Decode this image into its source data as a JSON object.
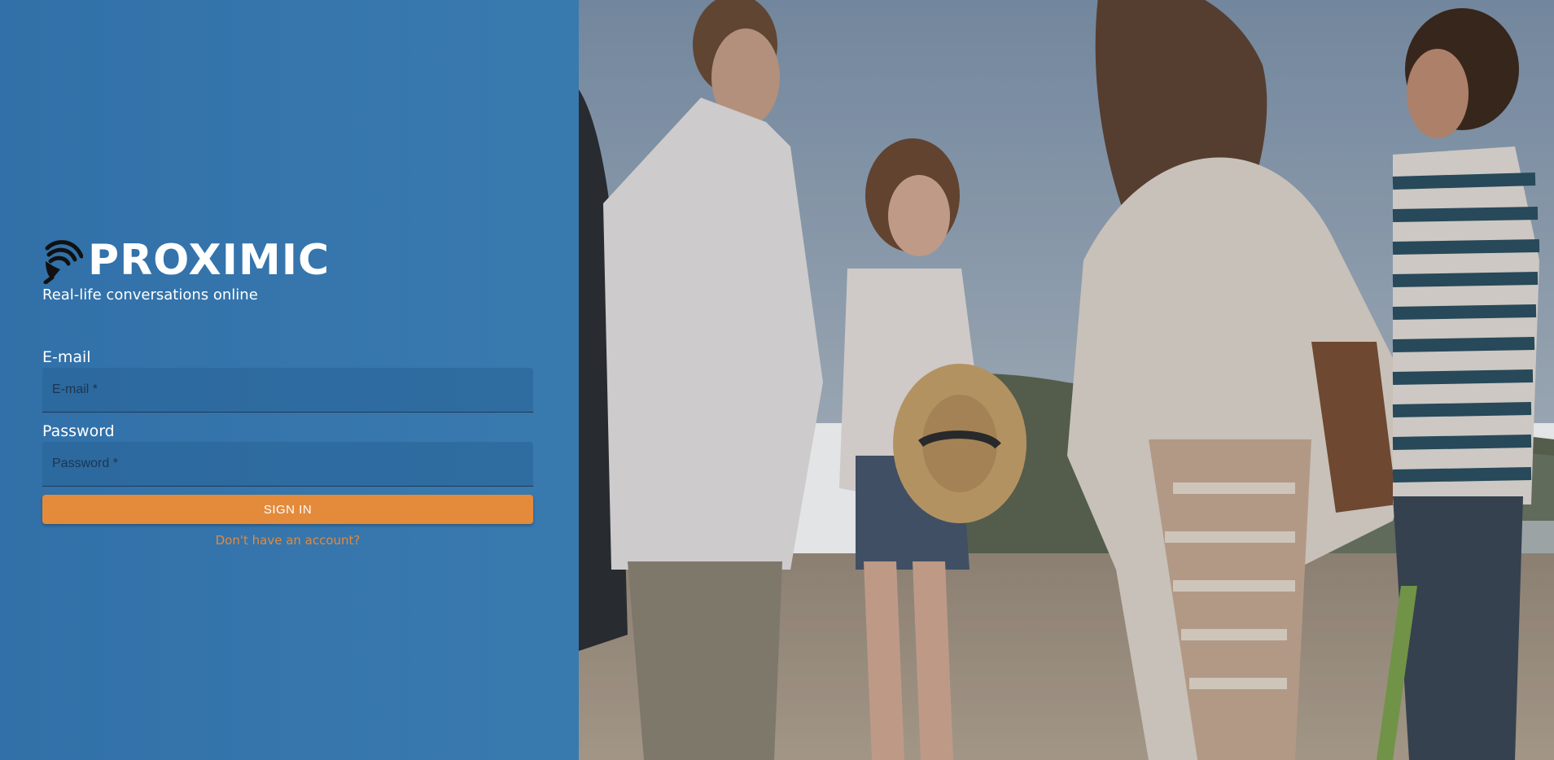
{
  "brand": {
    "name": "PROXIMIC",
    "tagline": "Real-life conversations online",
    "logo_icon": "microphone-signal-icon"
  },
  "login_form": {
    "email_label": "E-mail",
    "email_placeholder": "E-mail *",
    "email_value": "",
    "password_label": "Password",
    "password_placeholder": "Password *",
    "password_value": "",
    "signin_button_label": "SIGN IN",
    "signup_link_label": "Don't have an account?"
  },
  "colors": {
    "panel_background": "#3573ab",
    "accent_orange": "#e38a3b",
    "text_white": "#ffffff"
  },
  "hero_image": {
    "subject": "group of young people talking on a beach"
  }
}
